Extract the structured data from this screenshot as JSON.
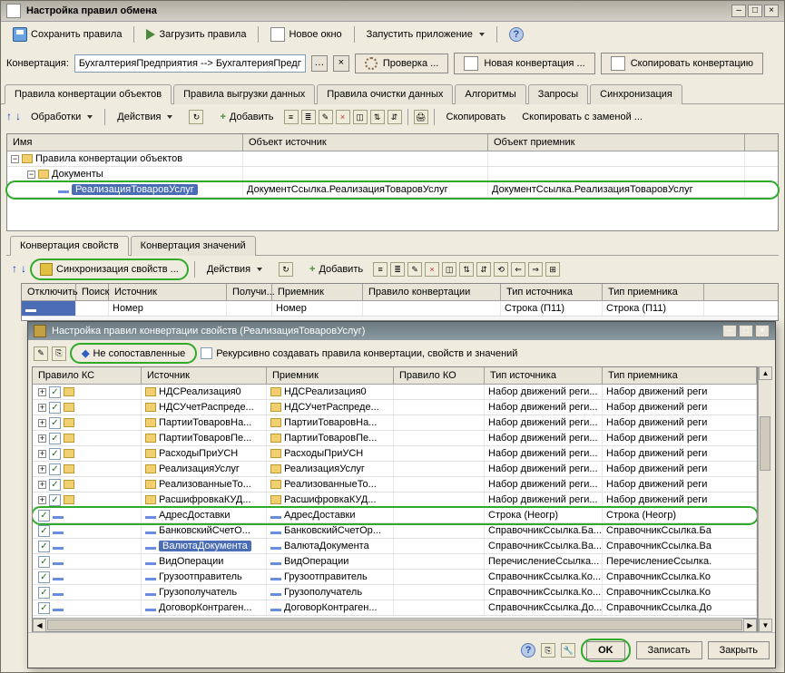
{
  "main_window": {
    "title": "Настройка правил обмена",
    "toolbar1": {
      "save": "Сохранить правила",
      "load": "Загрузить правила",
      "new_win": "Новое окно",
      "run_app": "Запустить приложение"
    },
    "conv_label": "Конвертация:",
    "conv_value": "БухгалтерияПредприятия --> БухгалтерияПредпри",
    "btns": {
      "check": "Проверка ...",
      "new_conv": "Новая конвертация ...",
      "copy_conv": "Скопировать конвертацию"
    },
    "tabs": [
      "Правила конвертации объектов",
      "Правила выгрузки данных",
      "Правила очистки данных",
      "Алгоритмы",
      "Запросы",
      "Синхронизация"
    ],
    "active_tab": 0,
    "toolbar2": {
      "proc": "Обработки",
      "actions": "Действия",
      "add": "Добавить",
      "copy": "Скопировать",
      "copy_rep": "Скопировать с заменой ..."
    },
    "grid1": {
      "headers": [
        "Имя",
        "Объект источник",
        "Объект приемник"
      ],
      "root": "Правила конвертации объектов",
      "docs": "Документы",
      "item": "РеализацияТоваровУслуг",
      "src": "ДокументСсылка.РеализацияТоваровУслуг",
      "dst": "ДокументСсылка.РеализацияТоваровУслуг"
    },
    "tabs2": [
      "Конвертация свойств",
      "Конвертация значений"
    ],
    "toolbar3": {
      "sync": "Синхронизация свойств ...",
      "actions": "Действия",
      "add": "Добавить"
    },
    "grid2": {
      "headers": [
        "Отключить",
        "Поиск",
        "Источник",
        "Получи...",
        "Приемник",
        "Правило конвертации",
        "Тип источника",
        "Тип приемника"
      ],
      "row_src": "Номер",
      "row_dst": "Номер",
      "row_srctype": "Строка (П11)",
      "row_dsttype": "Строка (П11)"
    }
  },
  "modal": {
    "title": "Настройка правил конвертации свойств (РеализацияТоваровУслуг)",
    "toolbar": {
      "unmatched": "Не сопоставленные",
      "recursive": "Рекурсивно создавать правила конвертации, свойств и значений"
    },
    "headers": [
      "Правило КС",
      "Источник",
      "Приемник",
      "Правило КО",
      "Тип источника",
      "Тип приемника"
    ],
    "rows": [
      {
        "t": "f",
        "src": "НДСРеализация0",
        "dst": "НДСРеализация0",
        "ko": "",
        "st": "Набор движений реги...",
        "dt": "Набор движений реги"
      },
      {
        "t": "f",
        "src": "НДСУчетРаспреде...",
        "dst": "НДСУчетРаспреде...",
        "ko": "",
        "st": "Набор движений реги...",
        "dt": "Набор движений реги"
      },
      {
        "t": "f",
        "src": "ПартииТоваровНа...",
        "dst": "ПартииТоваровНа...",
        "ko": "",
        "st": "Набор движений реги...",
        "dt": "Набор движений реги"
      },
      {
        "t": "f",
        "src": "ПартииТоваровПе...",
        "dst": "ПартииТоваровПе...",
        "ko": "",
        "st": "Набор движений реги...",
        "dt": "Набор движений реги"
      },
      {
        "t": "f",
        "src": "РасходыПриУСН",
        "dst": "РасходыПриУСН",
        "ko": "",
        "st": "Набор движений реги...",
        "dt": "Набор движений реги"
      },
      {
        "t": "f",
        "src": "РеализацияУслуг",
        "dst": "РеализацияУслуг",
        "ko": "",
        "st": "Набор движений реги...",
        "dt": "Набор движений реги"
      },
      {
        "t": "f",
        "src": "РеализованныеТо...",
        "dst": "РеализованныеТо...",
        "ko": "",
        "st": "Набор движений реги...",
        "dt": "Набор движений реги"
      },
      {
        "t": "f",
        "src": "РасшифровкаКУД...",
        "dst": "РасшифровкаКУД...",
        "ko": "",
        "st": "Набор движений реги...",
        "dt": "Набор движений реги"
      },
      {
        "t": "d",
        "hl": true,
        "src": "АдресДоставки",
        "dst": "АдресДоставки",
        "ko": "",
        "st": "Строка (Неогр)",
        "dt": "Строка (Неогр)"
      },
      {
        "t": "d",
        "src": "БанковскийСчетО...",
        "dst": "БанковскийСчетОр...",
        "ko": "",
        "st": "СправочникСсылка.Ба...",
        "dt": "СправочникСсылка.Ба"
      },
      {
        "t": "d",
        "sel": true,
        "src": "ВалютаДокумента",
        "dst": "ВалютаДокумента",
        "ko": "",
        "st": "СправочникСсылка.Ва...",
        "dt": "СправочникСсылка.Ва"
      },
      {
        "t": "d",
        "src": "ВидОперации",
        "dst": "ВидОперации",
        "ko": "",
        "st": "ПеречислениеСсылка...",
        "dt": "ПеречислениеСсылка."
      },
      {
        "t": "d",
        "src": "Грузоотправитель",
        "dst": "Грузоотправитель",
        "ko": "",
        "st": "СправочникСсылка.Ко...",
        "dt": "СправочникСсылка.Ко"
      },
      {
        "t": "d",
        "src": "Грузополучатель",
        "dst": "Грузополучатель",
        "ko": "",
        "st": "СправочникСсылка.Ко...",
        "dt": "СправочникСсылка.Ко"
      },
      {
        "t": "d",
        "src": "ДоговорКонтраген...",
        "dst": "ДоговорКонтраген...",
        "ko": "",
        "st": "СправочникСсылка.До...",
        "dt": "СправочникСсылка.До"
      }
    ],
    "footer": {
      "ok": "OK",
      "write": "Записать",
      "close": "Закрыть"
    }
  }
}
